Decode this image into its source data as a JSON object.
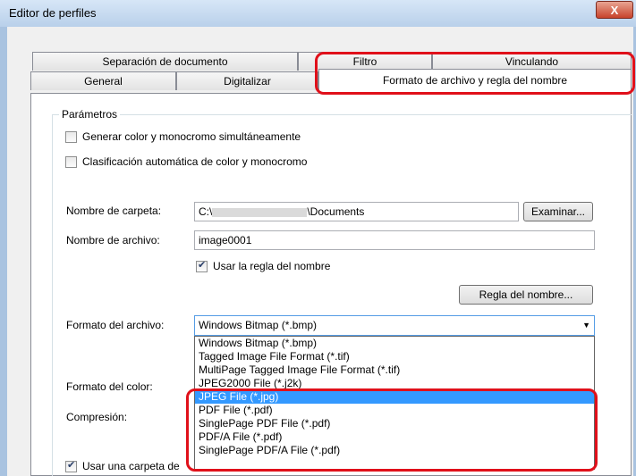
{
  "window": {
    "title": "Editor de perfiles",
    "close": "X"
  },
  "tabs": {
    "row1": [
      "Separación de documento",
      "Filtro",
      "Vinculando"
    ],
    "row2": [
      "General",
      "Digitalizar"
    ],
    "active": "Formato de archivo y regla del nombre"
  },
  "group": {
    "label": "Parámetros"
  },
  "options": {
    "color_mono": "Generar color y monocromo simultáneamente",
    "auto_classify": "Clasificación automática de color y monocromo"
  },
  "folder": {
    "label": "Nombre de carpeta:",
    "prefix": "C:\\",
    "suffix": "\\Documents",
    "browse": "Examinar..."
  },
  "filename": {
    "label": "Nombre de archivo:",
    "value": "image0001",
    "naming_rule_check": "Usar la regla del nombre",
    "naming_rule_button": "Regla del nombre..."
  },
  "file_format": {
    "label": "Formato del archivo:",
    "selected": "Windows Bitmap (*.bmp)",
    "options": [
      "Windows Bitmap (*.bmp)",
      "Tagged Image File Format (*.tif)",
      "MultiPage Tagged Image File Format (*.tif)",
      "JPEG2000 File (*.j2k)",
      "JPEG File (*.jpg)",
      "PDF File (*.pdf)",
      "SinglePage PDF File (*.pdf)",
      "PDF/A File (*.pdf)",
      "SinglePage PDF/A File (*.pdf)"
    ],
    "highlighted_index": 4
  },
  "color_format": {
    "label": "Formato del color:"
  },
  "compression": {
    "label": "Compresión:"
  },
  "subfolder": {
    "label": "Usar una carpeta de"
  },
  "colors": {
    "highlight_red": "#e0101a",
    "selection": "#3399ff"
  }
}
